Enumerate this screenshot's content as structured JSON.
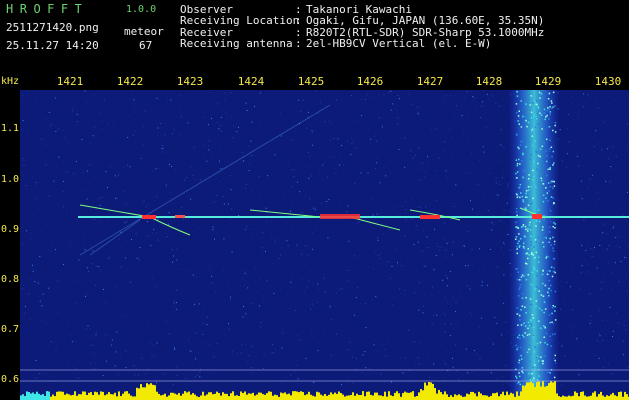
{
  "header": {
    "app_title": "HROFFT",
    "app_version": "1.0.0",
    "file_name": "2511271420.png",
    "meteor_label": "meteor",
    "date_time": "25.11.27 14:20",
    "meteor_count": "67"
  },
  "info": [
    {
      "key": "Observer",
      "value": "Takanori Kawachi"
    },
    {
      "key": "Receiving Location",
      "value": "Ogaki, Gifu, JAPAN (136.60E, 35.35N)"
    },
    {
      "key": "Receiver",
      "value": "R820T2(RTL-SDR) SDR-Sharp 53.1000MHz"
    },
    {
      "key": "Receiving antenna",
      "value": "2el-HB9CV Vertical (el. E-W)"
    }
  ],
  "axes": {
    "y_unit": "kHz",
    "y_ticks": [
      "1.1",
      "1.0",
      "0.9",
      "0.8",
      "0.7",
      "0.6"
    ],
    "x_ticks": [
      "1421",
      "1422",
      "1423",
      "1424",
      "1425",
      "1426",
      "1427",
      "1428",
      "1429",
      "1430"
    ]
  },
  "colors": {
    "label_yellow": "#f5e94a",
    "title_green": "#6cd36c",
    "spectrogram_bg": "#0c1a78",
    "signal_cyan": "#3fe6e6",
    "meteor_red": "#ff3030",
    "power_bar": "#f2ea00"
  }
}
